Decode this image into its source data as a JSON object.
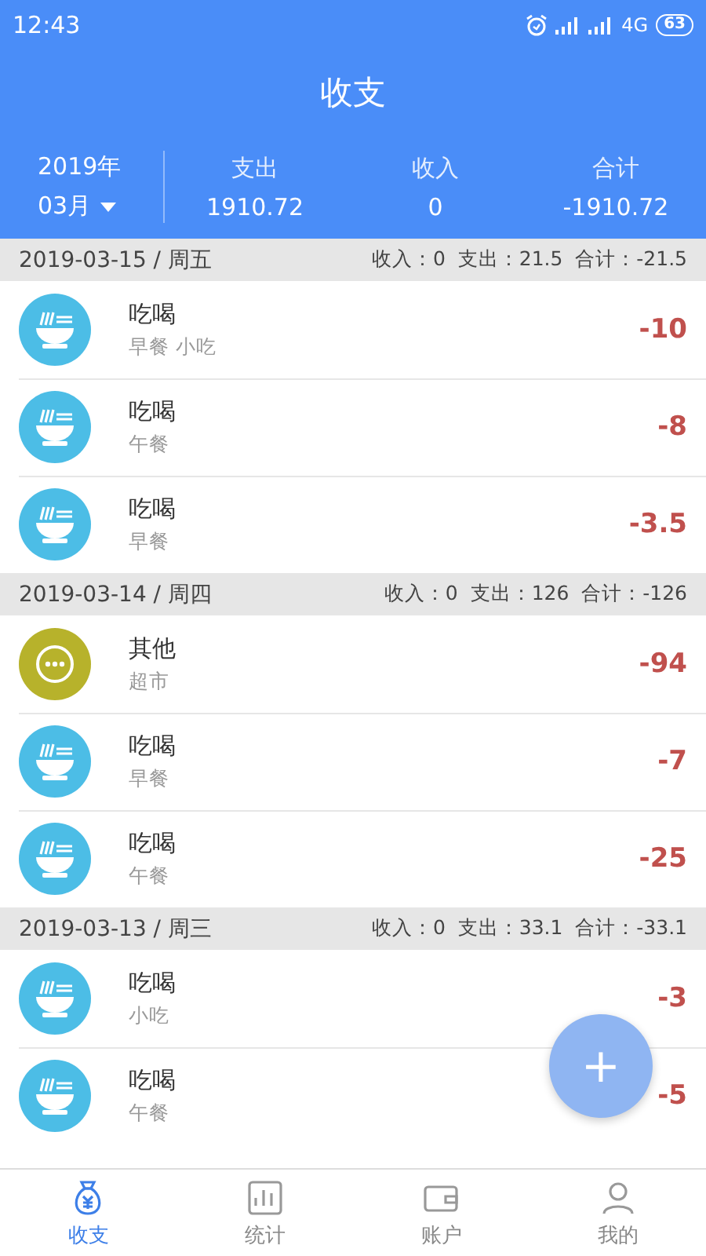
{
  "status_bar": {
    "time": "12:43",
    "network": "4G",
    "battery": "63"
  },
  "title": "收支",
  "summary": {
    "year": "2019年",
    "month": "03月",
    "columns": [
      {
        "label": "支出",
        "value": "1910.72"
      },
      {
        "label": "收入",
        "value": "0"
      },
      {
        "label": "合计",
        "value": "-1910.72"
      }
    ]
  },
  "days": [
    {
      "date": "2019-03-15 / 周五",
      "totals": "收入：0  支出：21.5  合计：-21.5",
      "entries": [
        {
          "kind": "food",
          "category": "吃喝",
          "note": "早餐 小吃",
          "amount": "-10"
        },
        {
          "kind": "food",
          "category": "吃喝",
          "note": "午餐",
          "amount": "-8"
        },
        {
          "kind": "food",
          "category": "吃喝",
          "note": "早餐",
          "amount": "-3.5"
        }
      ]
    },
    {
      "date": "2019-03-14 / 周四",
      "totals": "收入：0  支出：126  合计：-126",
      "entries": [
        {
          "kind": "other",
          "category": "其他",
          "note": "超市",
          "amount": "-94"
        },
        {
          "kind": "food",
          "category": "吃喝",
          "note": "早餐",
          "amount": "-7"
        },
        {
          "kind": "food",
          "category": "吃喝",
          "note": "午餐",
          "amount": "-25"
        }
      ]
    },
    {
      "date": "2019-03-13 / 周三",
      "totals": "收入：0  支出：33.1  合计：-33.1",
      "entries": [
        {
          "kind": "food",
          "category": "吃喝",
          "note": "小吃",
          "amount": "-3"
        },
        {
          "kind": "food",
          "category": "吃喝",
          "note": "午餐",
          "amount": "-5"
        }
      ]
    }
  ],
  "fab": {
    "label": "+"
  },
  "bottom_nav": [
    {
      "kind": "money",
      "label": "收支",
      "selected": true
    },
    {
      "kind": "chart",
      "label": "统计",
      "selected": false
    },
    {
      "kind": "wallet",
      "label": "账户",
      "selected": false
    },
    {
      "kind": "person",
      "label": "我的",
      "selected": false
    }
  ]
}
